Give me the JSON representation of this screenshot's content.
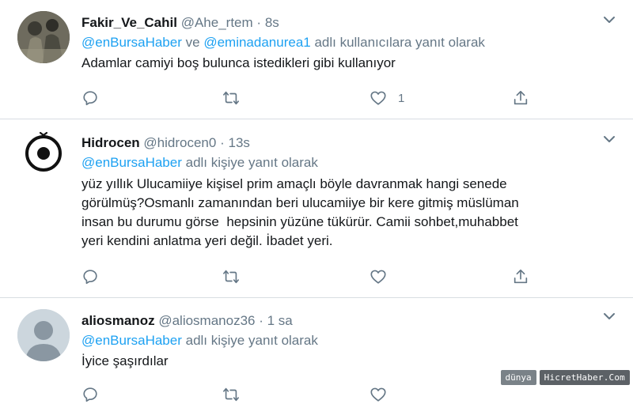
{
  "tweets": [
    {
      "display_name": "Fakir_Ve_Cahil",
      "handle": "@Ahe_rtem",
      "separator": "·",
      "time": "8s",
      "reply_mentions": [
        "@enBursaHaber",
        "@eminadanurea1"
      ],
      "reply_joiner": "ve",
      "reply_suffix": "adlı kullanıcılara yanıt olarak",
      "text": "Adamlar camiyi boş bulunca istedikleri gibi kullanıyor",
      "like_count": "1"
    },
    {
      "display_name": "Hidrocen",
      "handle": "@hidrocen0",
      "separator": "·",
      "time": "13s",
      "reply_mentions": [
        "@enBursaHaber"
      ],
      "reply_suffix": "adlı kişiye yanıt olarak",
      "text_lines": [
        "yüz yıllık Ulucamiiye kişisel prim amaçlı böyle davranmak hangi senede",
        "görülmüş?Osmanlı zamanından beri ulucamiiye bir kere gitmiş müslüman",
        "insan bu durumu görse  hepsinin yüzüne tükürür. Camii sohbet,muhabbet",
        "yeri kendini anlatma yeri değil. İbadet yeri."
      ]
    },
    {
      "display_name": "aliosmanoz",
      "handle": "@aliosmanoz36",
      "separator": "·",
      "time": "1 sa",
      "reply_mentions": [
        "@enBursaHaber"
      ],
      "reply_suffix": "adlı kişiye yanıt olarak",
      "text": "İyice şaşırdılar"
    }
  ],
  "icons": {
    "reply": "reply-icon",
    "retweet": "retweet-icon",
    "like": "like-icon",
    "share": "share-icon",
    "more": "chevron-down-icon"
  },
  "colors": {
    "link": "#1da1f2",
    "secondary": "#657786",
    "text": "#14171a",
    "divider": "#d8dde2"
  },
  "watermark": {
    "logo": "dünya",
    "text": "HicretHaber.Com"
  }
}
